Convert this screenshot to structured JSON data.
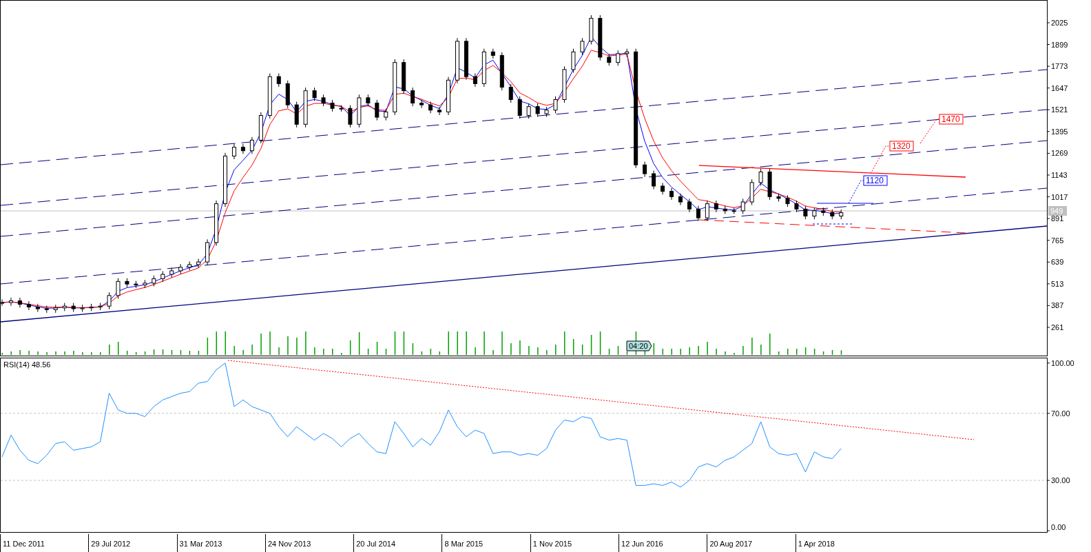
{
  "price_chart": {
    "price_axis": [
      "2025",
      "1899",
      "1773",
      "1647",
      "1521",
      "1395",
      "1269",
      "1143",
      "1017",
      "891",
      "765",
      "639",
      "513",
      "387",
      "261"
    ],
    "tags": [
      {
        "kind": "tag",
        "label": "1120",
        "color": "#0000ff"
      },
      {
        "kind": "tag",
        "label": "1320",
        "color": "#ff0000"
      },
      {
        "kind": "tag",
        "label": "1470",
        "color": "#ff0000"
      },
      {
        "kind": "current",
        "label": "949",
        "color": "#c0c0c0"
      }
    ],
    "timer": "04:20"
  },
  "rsi_chart": {
    "chart_data": {
      "type": "line",
      "title": "RSI(14) 48.56",
      "ylim": [
        -1,
        103
      ],
      "yticks": [
        {
          "value": 100,
          "label": "100.00"
        },
        {
          "value": 70,
          "label": "70.00"
        },
        {
          "value": 30,
          "label": "30.00"
        },
        {
          "value": 0,
          "label": "0.00"
        }
      ],
      "series": [
        {
          "color": "#1e90ff",
          "values": [
            44,
            57,
            48,
            42,
            40,
            45,
            52,
            53,
            48,
            49,
            50,
            53,
            82,
            72,
            70,
            70,
            68,
            74,
            78,
            80,
            82,
            83,
            88,
            89,
            96,
            100,
            74,
            78,
            74,
            72,
            70,
            62,
            56,
            62,
            58,
            54,
            58,
            55,
            50,
            55,
            58,
            52,
            47,
            46,
            65,
            58,
            50,
            55,
            51,
            59,
            72,
            62,
            56,
            60,
            58,
            46,
            47,
            47,
            45,
            46,
            45,
            49,
            60,
            66,
            65,
            68,
            67,
            56,
            54,
            55,
            54,
            27,
            27,
            28,
            27,
            29,
            26,
            30,
            38,
            40,
            38,
            42,
            44,
            48,
            52,
            65,
            50,
            46,
            45,
            46,
            35,
            47,
            44,
            43,
            49
          ]
        }
      ]
    }
  },
  "time_axis": [
    "11 Dec 2011",
    "29 Jul 2012",
    "31 Mar 2013",
    "24 Nov 2013",
    "20 Jul 2014",
    "8 Mar 2015",
    "1 Nov 2015",
    "12 Jun 2016",
    "20 Aug 2017",
    "1 Apr 2018"
  ]
}
